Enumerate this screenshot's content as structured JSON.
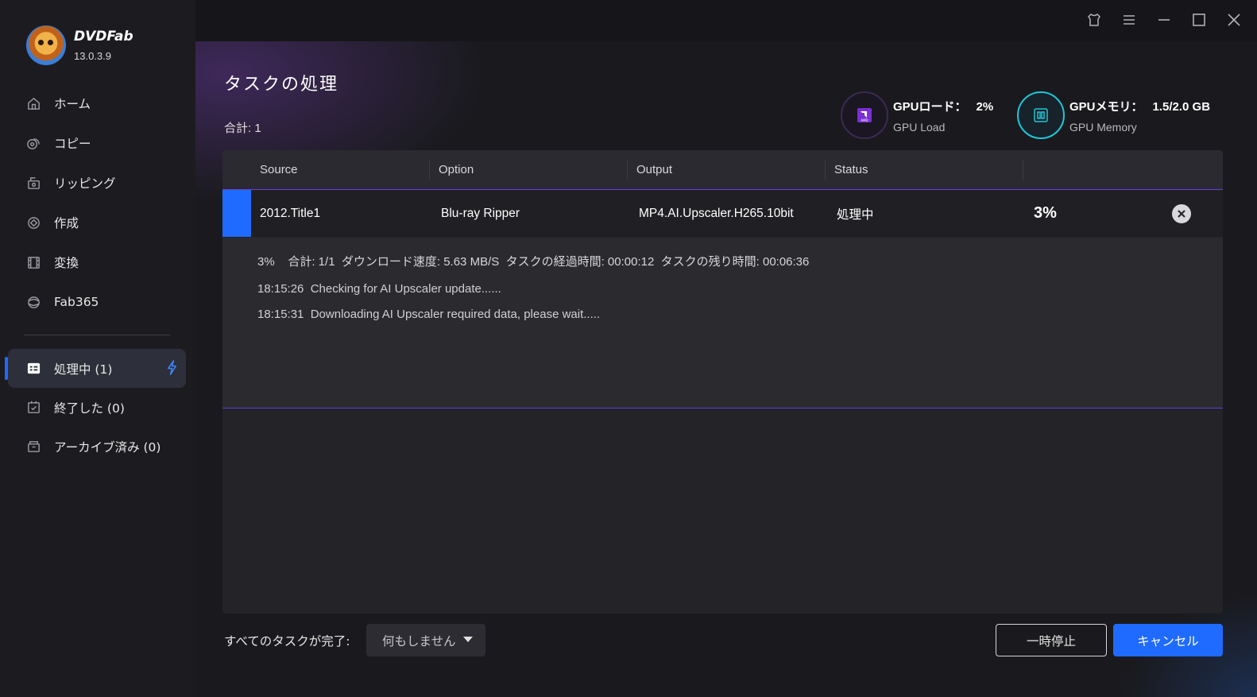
{
  "app": {
    "name": "DVDFab",
    "version": "13.0.3.9"
  },
  "sidebar": {
    "nav": [
      {
        "label": "ホーム",
        "icon": "home-icon"
      },
      {
        "label": "コピー",
        "icon": "copy-icon"
      },
      {
        "label": "リッピング",
        "icon": "ripping-icon"
      },
      {
        "label": "作成",
        "icon": "create-icon"
      },
      {
        "label": "変換",
        "icon": "convert-icon"
      },
      {
        "label": "Fab365",
        "icon": "fab365-icon"
      }
    ],
    "tasks": [
      {
        "label": "処理中 (1)",
        "icon": "processing-icon",
        "active": true
      },
      {
        "label": "終了した (0)",
        "icon": "finished-icon",
        "active": false
      },
      {
        "label": "アーカイブ済み (0)",
        "icon": "archive-icon",
        "active": false
      }
    ]
  },
  "main": {
    "title": "タスクの処理",
    "total": "合計: 1",
    "gpu_load": {
      "label": "GPUロード：",
      "value": "2%",
      "sub": "GPU Load",
      "brand": "AMD"
    },
    "gpu_memory": {
      "label": "GPUメモリ：",
      "value": "1.5/2.0 GB",
      "sub": "GPU Memory"
    }
  },
  "table": {
    "columns": [
      "Source",
      "Option",
      "Output",
      "Status"
    ],
    "rows": [
      {
        "source": "2012.Title1",
        "option": "Blu-ray Ripper",
        "output": "MP4.AI.Upscaler.H265.10bit",
        "status": "処理中",
        "percent": "3%"
      }
    ],
    "detail": {
      "stat_line": "3%    合計: 1/1  ダウンロード速度: 5.63 MB/S  タスクの経過時間: 00:00:12  タスクの残り時間: 00:06:36",
      "logs": [
        "18:15:26  Checking for AI Upscaler update......",
        "18:15:31  Downloading AI Upscaler required data, please wait....."
      ]
    }
  },
  "footer": {
    "on_complete_label": "すべてのタスクが完了:",
    "on_complete_value": "何もしません",
    "pause_label": "一時停止",
    "cancel_label": "キャンセル"
  },
  "colors": {
    "accent": "#1f6bff",
    "purple_line": "#6a3fd6",
    "gpu_memory_ring": "#1ec8d8",
    "sidebar_bg": "#1c1c20",
    "panel_bg": "#232328"
  }
}
